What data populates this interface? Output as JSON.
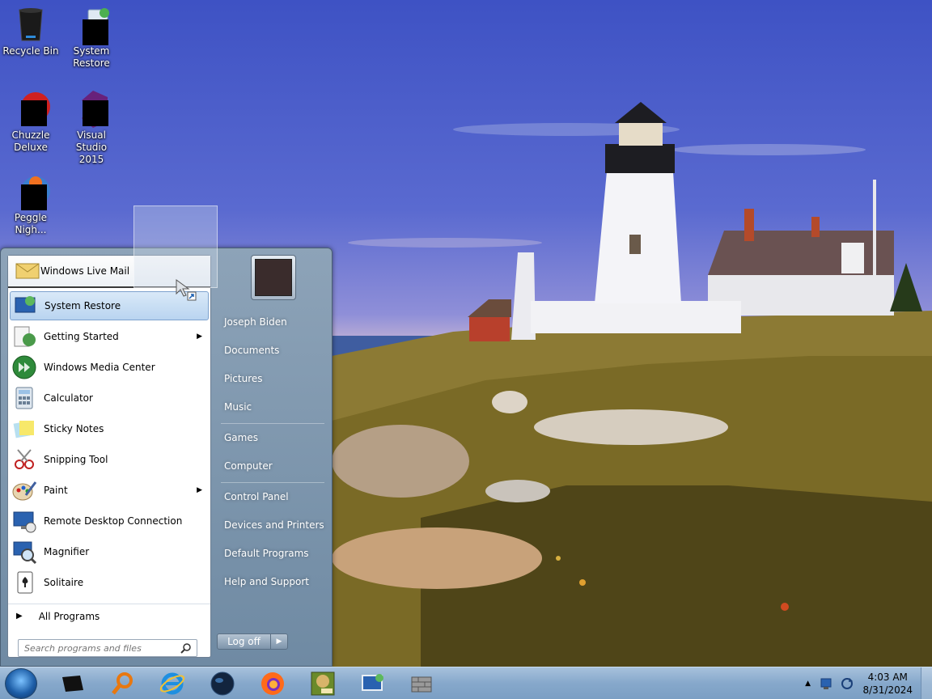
{
  "desktop": {
    "icons": [
      {
        "name": "recycle-bin",
        "label": "Recycle Bin"
      },
      {
        "name": "system-restore",
        "label": "System Restore"
      },
      {
        "name": "chuzzle-deluxe",
        "label": "Chuzzle Deluxe"
      },
      {
        "name": "visual-studio-2015",
        "label": "Visual Studio 2015"
      },
      {
        "name": "peggle-nights",
        "label": "Peggle Nigh..."
      }
    ]
  },
  "start_menu": {
    "pinned": {
      "label": "Windows Live Mail",
      "icon": "mail-icon"
    },
    "items": [
      {
        "label": "System Restore",
        "icon": "system-restore-icon",
        "selected": true,
        "submenu": false
      },
      {
        "label": "Getting Started",
        "icon": "getting-started-icon",
        "selected": false,
        "submenu": true
      },
      {
        "label": "Windows Media Center",
        "icon": "media-center-icon",
        "selected": false,
        "submenu": false
      },
      {
        "label": "Calculator",
        "icon": "calculator-icon",
        "selected": false,
        "submenu": false
      },
      {
        "label": "Sticky Notes",
        "icon": "sticky-notes-icon",
        "selected": false,
        "submenu": false
      },
      {
        "label": "Snipping Tool",
        "icon": "snipping-tool-icon",
        "selected": false,
        "submenu": false
      },
      {
        "label": "Paint",
        "icon": "paint-icon",
        "selected": false,
        "submenu": true
      },
      {
        "label": "Remote Desktop Connection",
        "icon": "remote-desktop-icon",
        "selected": false,
        "submenu": false
      },
      {
        "label": "Magnifier",
        "icon": "magnifier-icon",
        "selected": false,
        "submenu": false
      },
      {
        "label": "Solitaire",
        "icon": "solitaire-icon",
        "selected": false,
        "submenu": false
      }
    ],
    "all_programs": "All Programs",
    "search_placeholder": "Search programs and files",
    "right_links": [
      "Joseph Biden",
      "Documents",
      "Pictures",
      "Music",
      "Games",
      "Computer",
      "Control Panel",
      "Devices and Printers",
      "Default Programs",
      "Help and Support"
    ],
    "logoff_label": "Log off"
  },
  "taskbar": {
    "buttons": [
      "terminal-icon",
      "search-tool-icon",
      "internet-explorer-icon",
      "globe-icon",
      "firefox-icon",
      "game-box-icon",
      "system-restore-icon",
      "wall-icon"
    ],
    "tray_icons": [
      "chevron-up-icon",
      "network-icon",
      "sync-icon"
    ],
    "clock_time": "4:03 AM",
    "clock_date": "8/31/2024"
  },
  "colors": {
    "sky": "#3e52c4",
    "start_menu_bg": "#7d94ab",
    "selected_item": "#c8def5",
    "taskbar": "#86a8cb"
  }
}
